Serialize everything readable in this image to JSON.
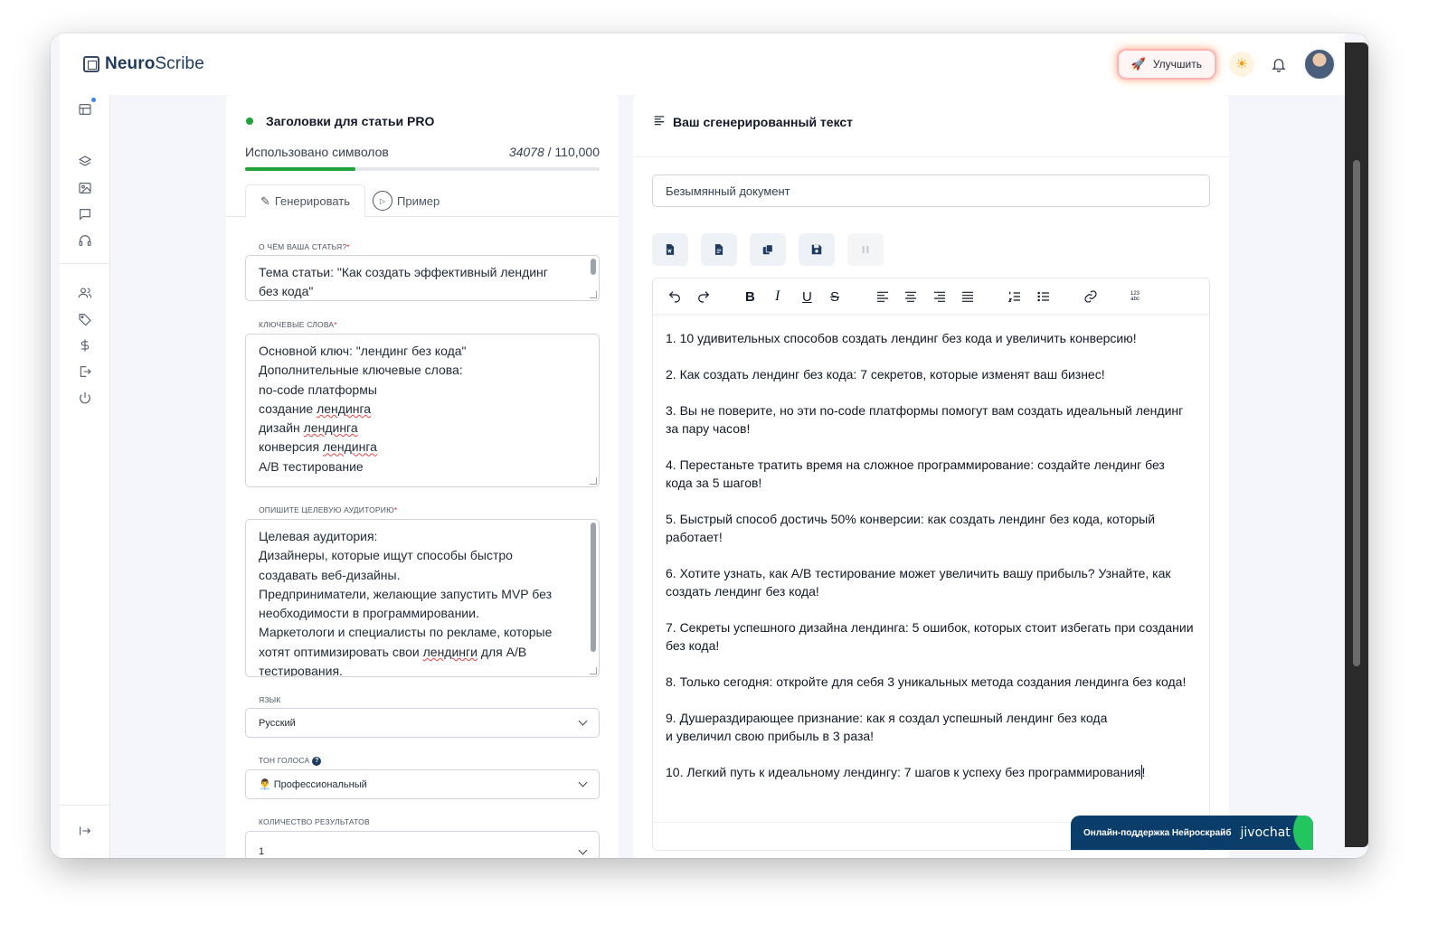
{
  "app": {
    "name_bold": "Neuro",
    "name_rest": "Scribe"
  },
  "header": {
    "upgrade_label": "Улучшить"
  },
  "sidebar": {
    "items": [
      {
        "icon": "layout-icon"
      },
      {
        "icon": "layers-icon"
      },
      {
        "icon": "image-icon"
      },
      {
        "icon": "chat-icon"
      },
      {
        "icon": "headphones-icon"
      },
      {
        "icon": "users-icon"
      },
      {
        "icon": "tag-icon"
      },
      {
        "icon": "dollar-icon"
      },
      {
        "icon": "logout-icon"
      },
      {
        "icon": "power-icon"
      }
    ],
    "collapse_icon": "expand-arrow-icon"
  },
  "form": {
    "title": "Заголовки для статьи PRO",
    "usage_label": "Использовано символов",
    "usage_used": "34078",
    "usage_total": "/ 110,000",
    "usage_fraction": 0.31,
    "tab_generate": "Генерировать",
    "tab_example": "Пример",
    "topic_label": "О чём ваша статья?",
    "topic_lines": [
      "Тема статьи: \"Как создать эффективный лендинг",
      "без кода\""
    ],
    "keywords_label": "Ключевые слова",
    "keywords_lines": [
      "Основной ключ: \"лендинг без кода\"",
      "Дополнительные ключевые слова:",
      "no-code платформы",
      "создание лендинга",
      "дизайн лендинга",
      "конверсия лендинга",
      "A/B тестирование"
    ],
    "audience_label": "Опишите целевую аудиторию",
    "audience_lines": [
      "Целевая аудитория:",
      "Дизайнеры, которые ищут способы быстро",
      "создавать веб-дизайны.",
      "Предприниматели, желающие запустить MVP без",
      "необходимости в программировании.",
      "Маркетологи и специалисты по рекламе, которые",
      "хотят оптимизировать свои лендинги для A/B",
      "тестирования."
    ],
    "language_label": "Язык",
    "language_value": "Русский",
    "tone_label": "Тон голоса",
    "tone_value": "👨‍💼 Профессиональный",
    "count_label": "Количество результатов",
    "count_value": "1",
    "required_mark": "*",
    "help_mark": "?"
  },
  "output": {
    "title": "Ваш сгенерированный текст",
    "document_name": "Безымянный документ",
    "items": [
      "1. 10 удивительных способов создать лендинг без кода и увеличить конверсию!",
      "2. Как создать лендинг без кода: 7 секретов, которые изменят ваш бизнес!",
      "3. Вы не поверите, но эти no-code платформы помогут вам создать идеальный лендинг за пару часов!",
      "4. Перестаньте тратить время на сложное программирование: создайте лендинг без кода за 5 шагов!",
      "5. Быстрый способ достичь 50% конверсии: как создать лендинг без кода, который работает!",
      "6. Хотите узнать, как A/B тестирование может увеличить вашу прибыль? Узнайте, как создать лендинг без кода!",
      "7. Секреты успешного дизайна лендинга: 5 ошибок, которых стоит избегать при создании без кода!",
      "8. Только сегодня: откройте для себя 3 уникальных метода создания лендинга без кода!",
      "9. Душераздирающее признание: как я создал успешный лендинг без кода",
      "и увеличил свою прибыль в 3 раза!",
      "10. Легкий путь к идеальному лендингу: 7 шагов к успеху без программирования"
    ],
    "last_char": "!"
  },
  "chat": {
    "label": "Онлайн-поддержка Нейроскрайб",
    "brand": "jivochat"
  }
}
